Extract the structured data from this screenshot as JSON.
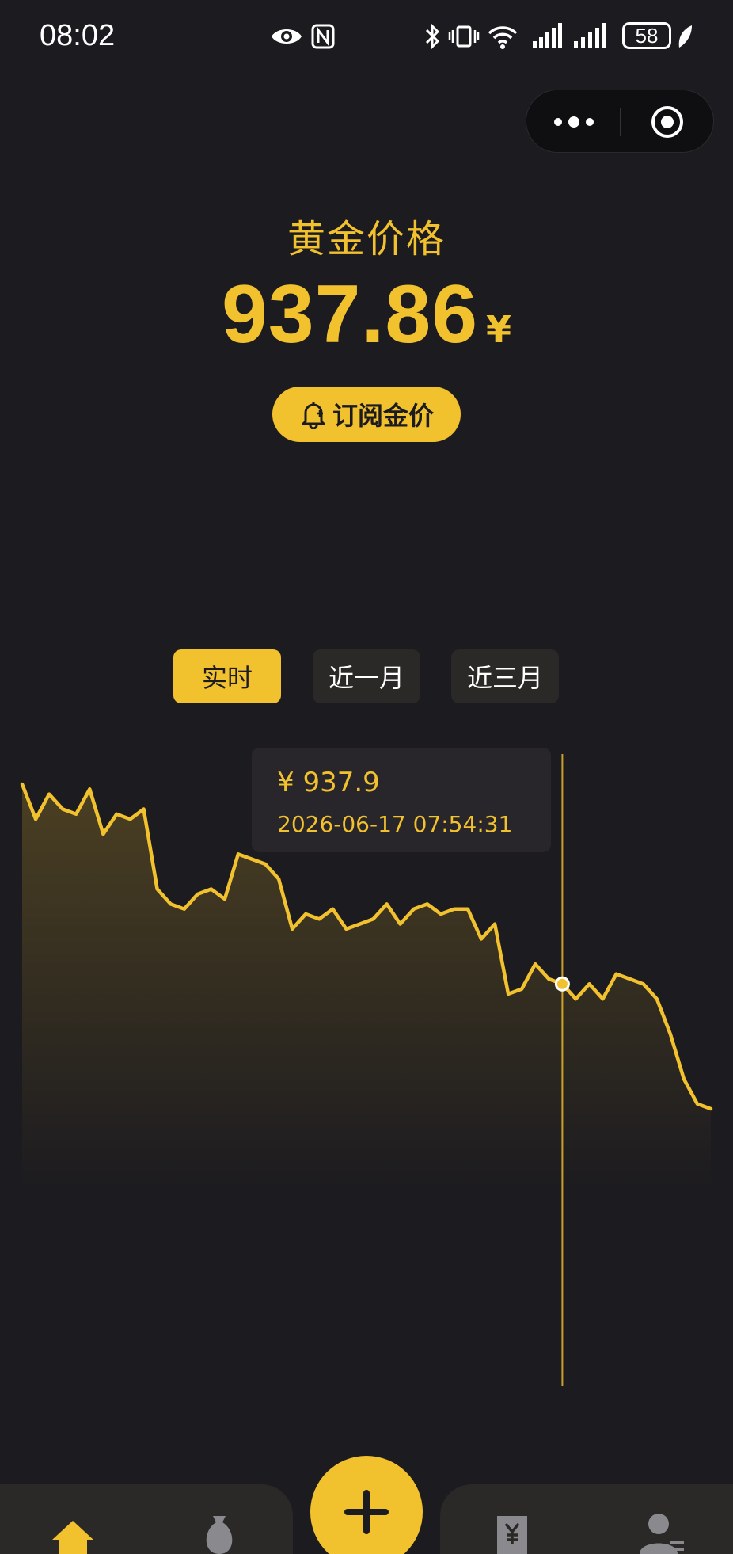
{
  "status_bar": {
    "time": "08:02",
    "battery": "58",
    "icons": [
      "eye-icon",
      "nfc-icon",
      "bluetooth-icon",
      "vibrate-icon",
      "wifi-icon",
      "signal-icon",
      "signal-icon-2",
      "battery-icon",
      "leaf-icon"
    ]
  },
  "capsule": {
    "more_icon": "more-dots-icon",
    "close_icon": "target-circle-icon"
  },
  "header": {
    "title": "黄金价格",
    "price": "937.86",
    "unit": "¥",
    "subscribe_label": "订阅金价",
    "subscribe_icon": "bell-icon"
  },
  "tabs": [
    {
      "label": "实时",
      "active": true
    },
    {
      "label": "近一月",
      "active": false
    },
    {
      "label": "近三月",
      "active": false
    }
  ],
  "tooltip": {
    "price": "¥ 937.9",
    "time": "2026-06-17 07:54:31"
  },
  "colors": {
    "accent": "#f2c12e",
    "background": "#1c1b1f",
    "surface": "#2b2927"
  },
  "chart_data": {
    "type": "area",
    "title": "",
    "xlabel": "",
    "ylabel": "",
    "values": [
      946.5,
      945.8,
      946.3,
      946.0,
      945.9,
      946.4,
      945.5,
      945.9,
      945.8,
      946.0,
      944.4,
      944.1,
      944.0,
      944.3,
      944.4,
      944.2,
      945.1,
      945.0,
      944.9,
      944.6,
      943.6,
      943.9,
      943.8,
      944.0,
      943.6,
      943.7,
      943.8,
      944.1,
      943.7,
      944.0,
      944.1,
      943.9,
      944.0,
      944.0,
      943.4,
      943.7,
      942.3,
      942.4,
      942.9,
      942.6,
      942.5,
      942.2,
      942.5,
      942.2,
      942.7,
      942.6,
      942.5,
      942.2,
      941.5,
      940.6,
      940.1,
      940.0
    ],
    "highlight": {
      "time": "2026-06-17 07:54:31",
      "value": 937.9
    },
    "grid": false,
    "legend": "none"
  },
  "bottom_nav": {
    "items": [
      {
        "icon": "home-icon",
        "active": true
      },
      {
        "icon": "money-bag-icon",
        "active": false
      },
      {
        "icon": "add-icon",
        "active": false
      },
      {
        "icon": "yuan-receipt-icon",
        "active": false
      },
      {
        "icon": "user-icon",
        "active": false
      }
    ]
  }
}
